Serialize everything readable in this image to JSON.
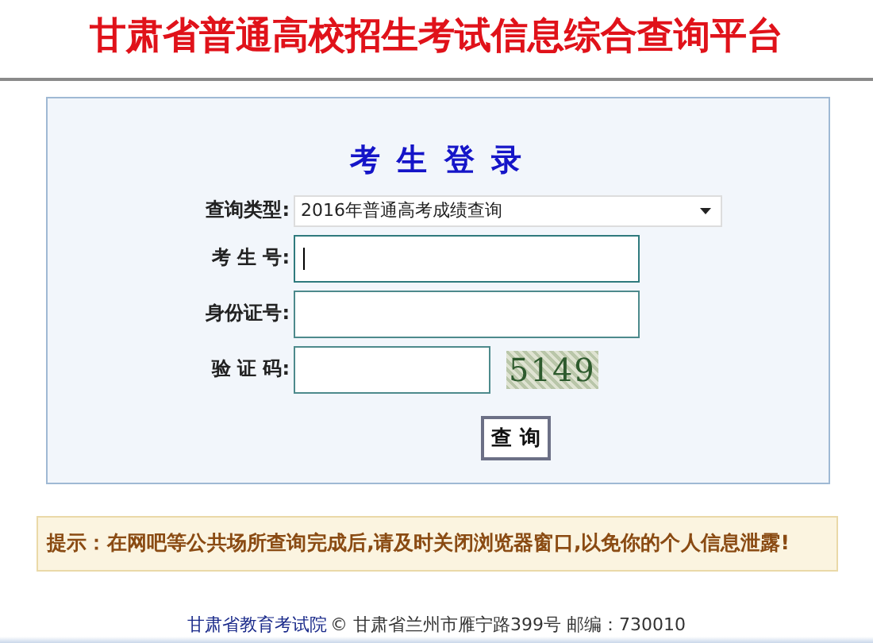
{
  "header": {
    "title": "甘肃省普通高校招生考试信息综合查询平台"
  },
  "login": {
    "title": "考 生 登 录",
    "fields": [
      {
        "kind": "select",
        "label": "查询类型:",
        "value": "2016年普通高考成绩查询"
      },
      {
        "kind": "input",
        "label": "考 生 号:",
        "focused": true
      },
      {
        "kind": "input",
        "label": "身份证号:",
        "focused": false
      },
      {
        "kind": "captcha",
        "label": "验 证 码:",
        "captcha": "5149"
      }
    ],
    "button": "查 询"
  },
  "notice": "提示：在网吧等公共场所查询完成后,请及时关闭浏览器窗口,以免你的个人信息泄露!",
  "footer": {
    "link": "甘肃省教育考试院",
    "text": "© 甘肃省兰州市雁宁路399号 邮编：730010"
  }
}
